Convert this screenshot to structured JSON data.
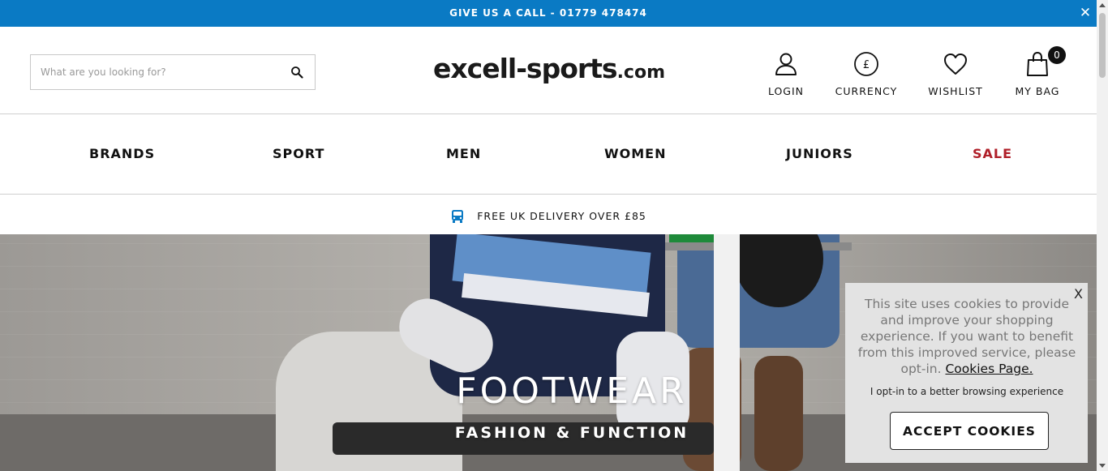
{
  "topbar": {
    "call_text": "GIVE US A CALL - 01779 478474",
    "close_glyph": "✕"
  },
  "header": {
    "search": {
      "placeholder": "What are you looking for?",
      "value": ""
    },
    "logo": {
      "main": "excell-sports",
      "tld": ".com"
    },
    "login_label": "LOGIN",
    "currency_label": "CURRENCY",
    "currency_symbol": "£",
    "wishlist_label": "WISHLIST",
    "bag_label": "MY BAG",
    "bag_count": "0"
  },
  "nav": {
    "items": [
      "BRANDS",
      "SPORT",
      "MEN",
      "WOMEN",
      "JUNIORS",
      "SALE"
    ]
  },
  "delivery": {
    "text": "FREE UK DELIVERY OVER £85"
  },
  "hero": {
    "title": "FOOTWEAR",
    "subtitle": "FASHION & FUNCTION"
  },
  "cookie": {
    "close_label": "X",
    "message": "This site uses cookies to provide and improve your shopping experience. If you want to benefit from this improved service, please opt-in.",
    "link_label": "Cookies Page.",
    "optin_text": "I opt-in to a better browsing experience",
    "accept_label": "ACCEPT COOKIES"
  },
  "colors": {
    "topbar": "#0a7ac4",
    "sale": "#b0202a",
    "accent_icon": "#0a7ac4",
    "cookie_bg": "#e3e3e3"
  },
  "icons": {
    "search": "search-icon",
    "login": "user-icon",
    "currency": "pound-icon",
    "wishlist": "heart-icon",
    "bag": "shopping-bag-icon",
    "delivery": "van-icon"
  }
}
